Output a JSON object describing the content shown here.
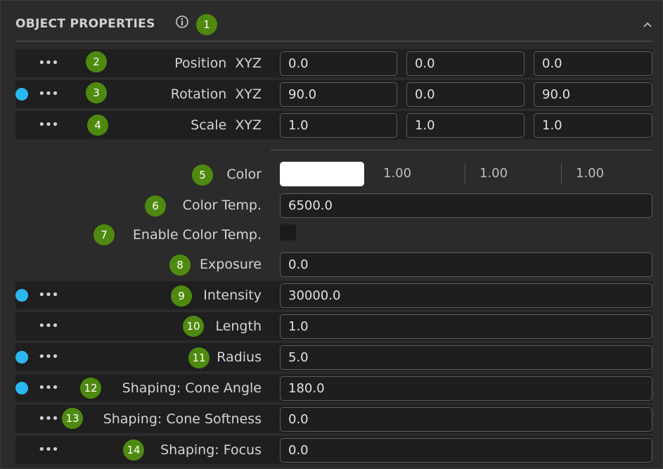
{
  "header": {
    "title": "OBJECT PROPERTIES",
    "info_icon": "info-icon",
    "collapse_icon": "chevron-up-icon"
  },
  "badges": [
    "1",
    "2",
    "3",
    "4",
    "5",
    "6",
    "7",
    "8",
    "9",
    "10",
    "11",
    "12",
    "13",
    "14"
  ],
  "transform": {
    "axis": "XYZ",
    "rows": [
      {
        "label": "Position",
        "values": [
          "0.0",
          "0.0",
          "0.0"
        ],
        "modified": false
      },
      {
        "label": "Rotation",
        "values": [
          "90.0",
          "0.0",
          "90.0"
        ],
        "modified": true
      },
      {
        "label": "Scale",
        "values": [
          "1.0",
          "1.0",
          "1.0"
        ],
        "modified": false
      }
    ]
  },
  "color": {
    "label": "Color",
    "swatch": "#ffffff",
    "values": [
      "1.00",
      "1.00",
      "1.00"
    ]
  },
  "color_temp": {
    "label": "Color Temp.",
    "value": "6500.0"
  },
  "enable_color_temp": {
    "label": "Enable Color Temp.",
    "checked": false
  },
  "exposure": {
    "label": "Exposure",
    "value": "0.0"
  },
  "properties": [
    {
      "label": "Intensity",
      "value": "30000.0",
      "modified": true
    },
    {
      "label": "Length",
      "value": "1.0",
      "modified": false
    },
    {
      "label": "Radius",
      "value": "5.0",
      "modified": true
    },
    {
      "label": "Shaping: Cone Angle",
      "value": "180.0",
      "modified": true
    },
    {
      "label": "Shaping: Cone Softness",
      "value": "0.0",
      "modified": false
    },
    {
      "label": "Shaping: Focus",
      "value": "0.0",
      "modified": false
    }
  ],
  "colors": {
    "badge": "#4f8a10",
    "modified_dot": "#2ab7f0",
    "background": "#2b2b2b",
    "row_dark": "#1f1f1f",
    "field_bg": "#1e1e1e"
  }
}
